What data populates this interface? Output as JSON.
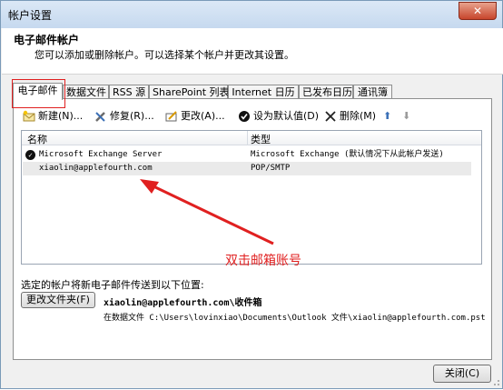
{
  "window": {
    "title": "帐户设置",
    "close_glyph": "✕"
  },
  "header": {
    "title": "电子邮件帐户",
    "subtitle": "您可以添加或删除帐户。可以选择某个帐户并更改其设置。"
  },
  "tabs": [
    {
      "label": "电子邮件",
      "active": true
    },
    {
      "label": "数据文件"
    },
    {
      "label": "RSS 源"
    },
    {
      "label": "SharePoint 列表"
    },
    {
      "label": "Internet 日历"
    },
    {
      "label": "已发布日历"
    },
    {
      "label": "通讯簿"
    }
  ],
  "toolbar": {
    "new_label": "新建(N)...",
    "repair_label": "修复(R)...",
    "change_label": "更改(A)...",
    "default_label": "设为默认值(D)",
    "remove_label": "删除(M)",
    "up_glyph": "⬆",
    "down_glyph": "⬇"
  },
  "list": {
    "col_name": "名称",
    "col_type": "类型",
    "rows": [
      {
        "name": "Microsoft Exchange Server",
        "type": "Microsoft Exchange (默认情况下从此帐户发送)",
        "default": true
      },
      {
        "name": "xiaolin@applefourth.com",
        "type": "POP/SMTP",
        "default": false
      }
    ]
  },
  "annotation": {
    "text": "双击邮箱账号",
    "color": "#e02020"
  },
  "delivery": {
    "label": "选定的帐户将新电子邮件传送到以下位置:",
    "change_folder_label": "更改文件夹(F)",
    "inbox_path": "xiaolin@applefourth.com\\收件箱",
    "pst_path": "在数据文件 C:\\Users\\lovinxiao\\Documents\\Outlook 文件\\xiaolin@applefourth.com.pst"
  },
  "footer": {
    "close_label": "关闭(C)"
  }
}
